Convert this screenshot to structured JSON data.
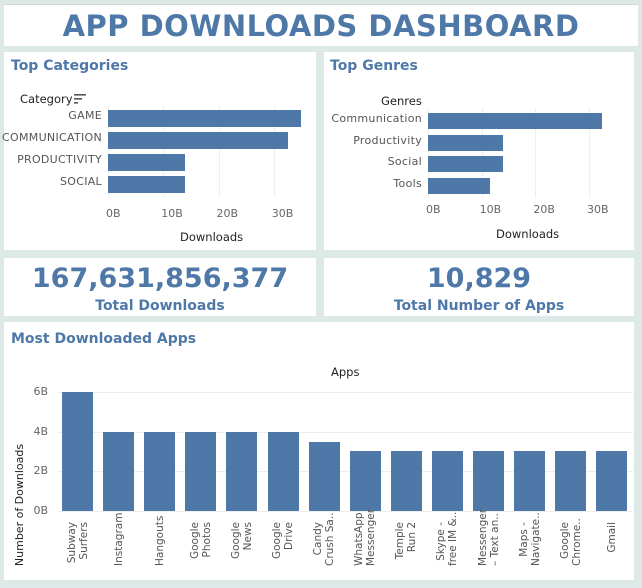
{
  "dashboard": {
    "title": "APP DOWNLOADS DASHBOARD"
  },
  "top_categories": {
    "title": "Top Categories",
    "header": "Category",
    "axis_title": "Downloads",
    "ticks": [
      "0B",
      "10B",
      "20B",
      "30B"
    ],
    "categories": [
      "GAME",
      "COMMUNICATION",
      "PRODUCTIVITY",
      "SOCIAL"
    ],
    "values": [
      35,
      32.5,
      14,
      14
    ]
  },
  "top_genres": {
    "title": "Top Genres",
    "header": "Genres",
    "axis_title": "Downloads",
    "ticks": [
      "0B",
      "10B",
      "20B",
      "30B"
    ],
    "categories": [
      "Communication",
      "Productivity",
      "Social",
      "Tools"
    ],
    "values": [
      32.5,
      14,
      14,
      11.5
    ]
  },
  "kpis": {
    "total_downloads": {
      "value": "167,631,856,377",
      "label": "Total Downloads"
    },
    "total_apps": {
      "value": "10,829",
      "label": "Total Number of Apps"
    }
  },
  "most_downloaded": {
    "title": "Most Downloaded Apps",
    "header": "Apps",
    "y_axis_title": "Number of Downloads",
    "y_ticks": [
      "0B",
      "2B",
      "4B",
      "6B"
    ],
    "apps": [
      {
        "label_line1": "Subway",
        "label_line2": "Surfers",
        "value": 6
      },
      {
        "label_line1": "Instagram",
        "label_line2": "",
        "value": 4
      },
      {
        "label_line1": "Hangouts",
        "label_line2": "",
        "value": 4
      },
      {
        "label_line1": "Google",
        "label_line2": "Photos",
        "value": 4
      },
      {
        "label_line1": "Google",
        "label_line2": "News",
        "value": 4
      },
      {
        "label_line1": "Google",
        "label_line2": "Drive",
        "value": 4
      },
      {
        "label_line1": "Candy",
        "label_line2": "Crush Sa..",
        "value": 3.5
      },
      {
        "label_line1": "WhatsApp",
        "label_line2": "Messenger",
        "value": 3
      },
      {
        "label_line1": "Temple",
        "label_line2": "Run 2",
        "value": 3
      },
      {
        "label_line1": "Skype -",
        "label_line2": "free IM &..",
        "value": 3
      },
      {
        "label_line1": "Messenger",
        "label_line2": "– Text an..",
        "value": 3
      },
      {
        "label_line1": "Maps -",
        "label_line2": "Navigate..",
        "value": 3
      },
      {
        "label_line1": "Google",
        "label_line2": "Chrome..",
        "value": 3
      },
      {
        "label_line1": "Gmail",
        "label_line2": "",
        "value": 3
      }
    ]
  },
  "chart_data": [
    {
      "type": "bar",
      "title": "Top Categories",
      "categories": [
        "GAME",
        "COMMUNICATION",
        "PRODUCTIVITY",
        "SOCIAL"
      ],
      "values": [
        35,
        32.5,
        14,
        14
      ],
      "xlabel": "Downloads",
      "ylabel": "Category",
      "xlim": [
        0,
        38
      ],
      "units": "B"
    },
    {
      "type": "bar",
      "title": "Top Genres",
      "categories": [
        "Communication",
        "Productivity",
        "Social",
        "Tools"
      ],
      "values": [
        32.5,
        14,
        14,
        11.5
      ],
      "xlabel": "Downloads",
      "ylabel": "Genres",
      "xlim": [
        0,
        38
      ],
      "units": "B"
    },
    {
      "type": "bar",
      "title": "Most Downloaded Apps",
      "categories": [
        "Subway Surfers",
        "Instagram",
        "Hangouts",
        "Google Photos",
        "Google News",
        "Google Drive",
        "Candy Crush Sa..",
        "WhatsApp Messenger",
        "Temple Run 2",
        "Skype - free IM &..",
        "Messenger – Text an..",
        "Maps - Navigate..",
        "Google Chrome..",
        "Gmail"
      ],
      "values": [
        6,
        4,
        4,
        4,
        4,
        4,
        3.5,
        3,
        3,
        3,
        3,
        3,
        3,
        3
      ],
      "xlabel": "Apps",
      "ylabel": "Number of Downloads",
      "ylim": [
        0,
        6.5
      ],
      "units": "B"
    }
  ]
}
